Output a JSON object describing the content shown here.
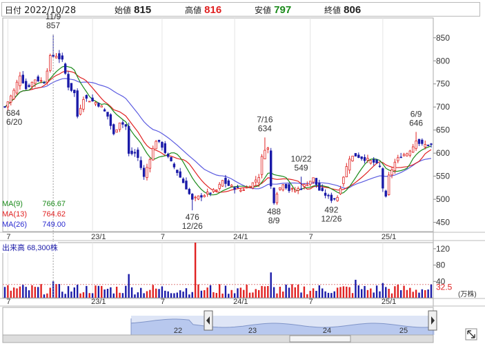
{
  "header": {
    "date_key": "日付",
    "date_value": "2022/10/28",
    "open_key": "始値",
    "open_value": "815",
    "high_key": "高値",
    "high_value": "816",
    "low_key": "安値",
    "low_value": "797",
    "close_key": "終値",
    "close_value": "806",
    "colors": {
      "high": "#e02020",
      "low": "#1a8a1a",
      "text": "#222222"
    }
  },
  "legend": {
    "ma9_label": "MA(9)",
    "ma9_value": "766.67",
    "ma9_color": "#1a8a1a",
    "ma13_label": "MA(13)",
    "ma13_value": "764.62",
    "ma13_color": "#e02020",
    "ma26_label": "MA(26)",
    "ma26_value": "749.00",
    "ma26_color": "#2a2ad0"
  },
  "volume_legend": {
    "label": "出来高",
    "value": "68,300株"
  },
  "volume_unit": "(万株)",
  "chart_data": {
    "type": "candlestick",
    "price_axis": {
      "ticks": [
        450,
        500,
        550,
        600,
        650,
        700,
        750,
        800,
        850
      ],
      "range": [
        430,
        893
      ]
    },
    "volume_axis": {
      "ticks": [
        40,
        80,
        120
      ],
      "range": [
        0,
        135
      ],
      "reference_label": "32.5",
      "reference_value": 32.5
    },
    "x_labels": [
      "7",
      "23/1",
      "7",
      "24/1",
      "7",
      "25/1"
    ],
    "colors": {
      "up": "#e02020",
      "down": "#1a1aa8",
      "ma9": "#1a8a1a",
      "ma13": "#e02020",
      "ma26": "#5a5ae0"
    },
    "close_path": [
      [
        0,
        700
      ],
      [
        3,
        735
      ],
      [
        5,
        770
      ],
      [
        7,
        740
      ],
      [
        10,
        760
      ],
      [
        13,
        755
      ],
      [
        15,
        808
      ],
      [
        17,
        812
      ],
      [
        19,
        800
      ],
      [
        21,
        745
      ],
      [
        23,
        730
      ],
      [
        24,
        680
      ],
      [
        26,
        720
      ],
      [
        28,
        715
      ],
      [
        30,
        710
      ],
      [
        32,
        700
      ],
      [
        34,
        680
      ],
      [
        36,
        640
      ],
      [
        38,
        668
      ],
      [
        40,
        658
      ],
      [
        41,
        598
      ],
      [
        43,
        600
      ],
      [
        44,
        590
      ],
      [
        46,
        548
      ],
      [
        48,
        590
      ],
      [
        50,
        628
      ],
      [
        52,
        615
      ],
      [
        54,
        590
      ],
      [
        56,
        570
      ],
      [
        58,
        548
      ],
      [
        60,
        525
      ],
      [
        62,
        498
      ],
      [
        64,
        505
      ],
      [
        66,
        510
      ],
      [
        68,
        515
      ],
      [
        70,
        520
      ],
      [
        72,
        540
      ],
      [
        74,
        530
      ],
      [
        76,
        525
      ],
      [
        78,
        520
      ],
      [
        80,
        525
      ],
      [
        82,
        535
      ],
      [
        84,
        550
      ],
      [
        85,
        590
      ],
      [
        86,
        610
      ],
      [
        87,
        610
      ],
      [
        88,
        528
      ],
      [
        89,
        496
      ],
      [
        90,
        515
      ],
      [
        92,
        535
      ],
      [
        94,
        520
      ],
      [
        96,
        520
      ],
      [
        98,
        525
      ],
      [
        100,
        535
      ],
      [
        102,
        545
      ],
      [
        104,
        520
      ],
      [
        106,
        510
      ],
      [
        108,
        500
      ],
      [
        110,
        505
      ],
      [
        112,
        550
      ],
      [
        114,
        590
      ],
      [
        116,
        595
      ],
      [
        118,
        590
      ],
      [
        120,
        585
      ],
      [
        122,
        580
      ],
      [
        124,
        570
      ],
      [
        125,
        525
      ],
      [
        126,
        503
      ],
      [
        127,
        550
      ],
      [
        129,
        580
      ],
      [
        131,
        595
      ],
      [
        133,
        600
      ],
      [
        135,
        615
      ],
      [
        136,
        630
      ],
      [
        137,
        622
      ],
      [
        138,
        618
      ]
    ],
    "annotations": [
      {
        "text": "11/9",
        "value": "857",
        "index": 16,
        "price": 857,
        "position": "above"
      },
      {
        "text": "684",
        "value": "6/20",
        "index": 0,
        "price": 684,
        "position": "left"
      },
      {
        "text": "476",
        "value": "12/26",
        "index": 62,
        "price": 476,
        "position": "below"
      },
      {
        "text": "7/16",
        "value": "634",
        "index": 86,
        "price": 634,
        "position": "above"
      },
      {
        "text": "488",
        "value": "8/9",
        "index": 89,
        "price": 488,
        "position": "below"
      },
      {
        "text": "10/22",
        "value": "549",
        "index": 98,
        "price": 549,
        "position": "above"
      },
      {
        "text": "492",
        "value": "12/26",
        "index": 108,
        "price": 492,
        "position": "below"
      },
      {
        "text": "6/9",
        "value": "646",
        "index": 136,
        "price": 646,
        "position": "above"
      }
    ],
    "navigator": {
      "labels": [
        "22",
        "23",
        "24",
        "25"
      ]
    }
  }
}
